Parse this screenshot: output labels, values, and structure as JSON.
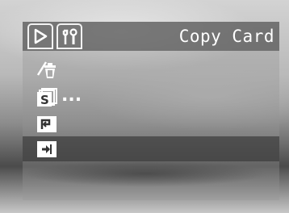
{
  "header": {
    "title": "Copy Card",
    "tabs": [
      {
        "icon": "playback-icon",
        "selected": true
      },
      {
        "icon": "setup-wrench-icon",
        "selected": false
      }
    ]
  },
  "menu": {
    "items": [
      {
        "icon": "erase-trash-icon"
      },
      {
        "icon": "slideshow-icon",
        "suffix": "..."
      },
      {
        "icon": "print-order-icon"
      },
      {
        "icon": "copy-to-card-icon",
        "selected": true
      }
    ]
  },
  "colors": {
    "header_bg": "#5f5f5f",
    "selected_row": "#3c3c3c",
    "text": "#ffffff"
  }
}
